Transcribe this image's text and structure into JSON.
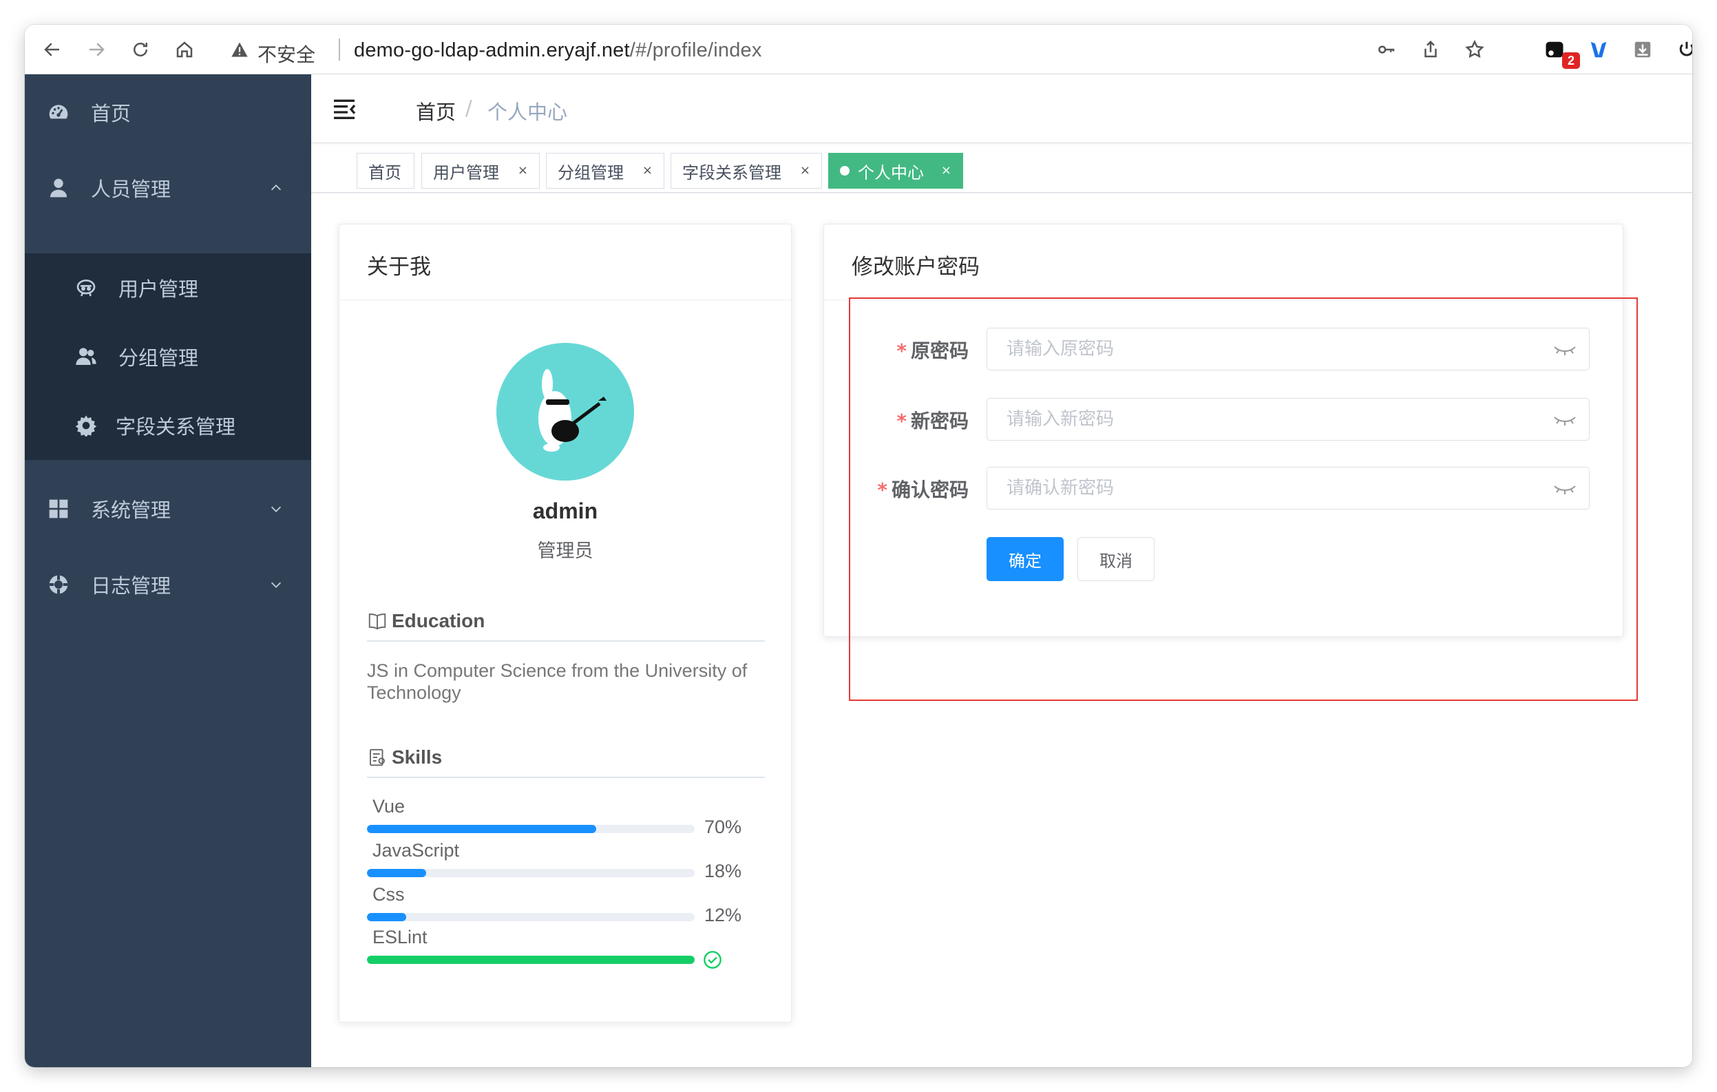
{
  "browser": {
    "security_label": "不安全",
    "url_host": "demo-go-ldap-admin.eryajf.net",
    "url_path": "/#/profile/index",
    "extension_badge": "2"
  },
  "sidebar": {
    "items": [
      {
        "label": "首页",
        "icon": "dashboard-icon"
      },
      {
        "label": "人员管理",
        "icon": "user-icon",
        "expanded": true
      },
      {
        "label": "系统管理",
        "icon": "grid-icon",
        "expanded": false
      },
      {
        "label": "日志管理",
        "icon": "lifebuoy-icon",
        "expanded": false
      }
    ],
    "subitems": [
      {
        "label": "用户管理",
        "icon": "robot-icon"
      },
      {
        "label": "分组管理",
        "icon": "peoples-icon"
      },
      {
        "label": "字段关系管理",
        "icon": "gear-icon"
      }
    ]
  },
  "breadcrumb": {
    "home": "首页",
    "separator": "/",
    "current": "个人中心"
  },
  "tags": [
    {
      "label": "首页",
      "closable": false,
      "active": false
    },
    {
      "label": "用户管理",
      "closable": true,
      "active": false
    },
    {
      "label": "分组管理",
      "closable": true,
      "active": false
    },
    {
      "label": "字段关系管理",
      "closable": true,
      "active": false
    },
    {
      "label": "个人中心",
      "closable": true,
      "active": true
    }
  ],
  "tag_close": "×",
  "about": {
    "title": "关于我",
    "username": "admin",
    "role": "管理员",
    "education_heading": "Education",
    "education_text": "JS in Computer Science from the University of Technology",
    "skills_heading": "Skills",
    "skills": [
      {
        "name": "Vue",
        "percent": 70,
        "label": "70%",
        "status": "active"
      },
      {
        "name": "JavaScript",
        "percent": 18,
        "label": "18%",
        "status": "active"
      },
      {
        "name": "Css",
        "percent": 12,
        "label": "12%",
        "status": "active"
      },
      {
        "name": "ESLint",
        "percent": 100,
        "label": "",
        "status": "success"
      }
    ]
  },
  "password": {
    "title": "修改账户密码",
    "fields": [
      {
        "label": "原密码",
        "placeholder": "请输入原密码",
        "value": "",
        "required": true
      },
      {
        "label": "新密码",
        "placeholder": "请输入新密码",
        "value": "",
        "required": true
      },
      {
        "label": "确认密码",
        "placeholder": "请确认新密码",
        "value": "",
        "required": true
      }
    ],
    "required_mark": "*",
    "confirm_label": "确定",
    "cancel_label": "取消"
  },
  "colors": {
    "sidebar_bg": "#304156",
    "submenu_bg": "#1f2d3d",
    "active_tag": "#42b983",
    "primary": "#1890ff",
    "success": "#13ce66",
    "highlight_border": "#e53935"
  }
}
